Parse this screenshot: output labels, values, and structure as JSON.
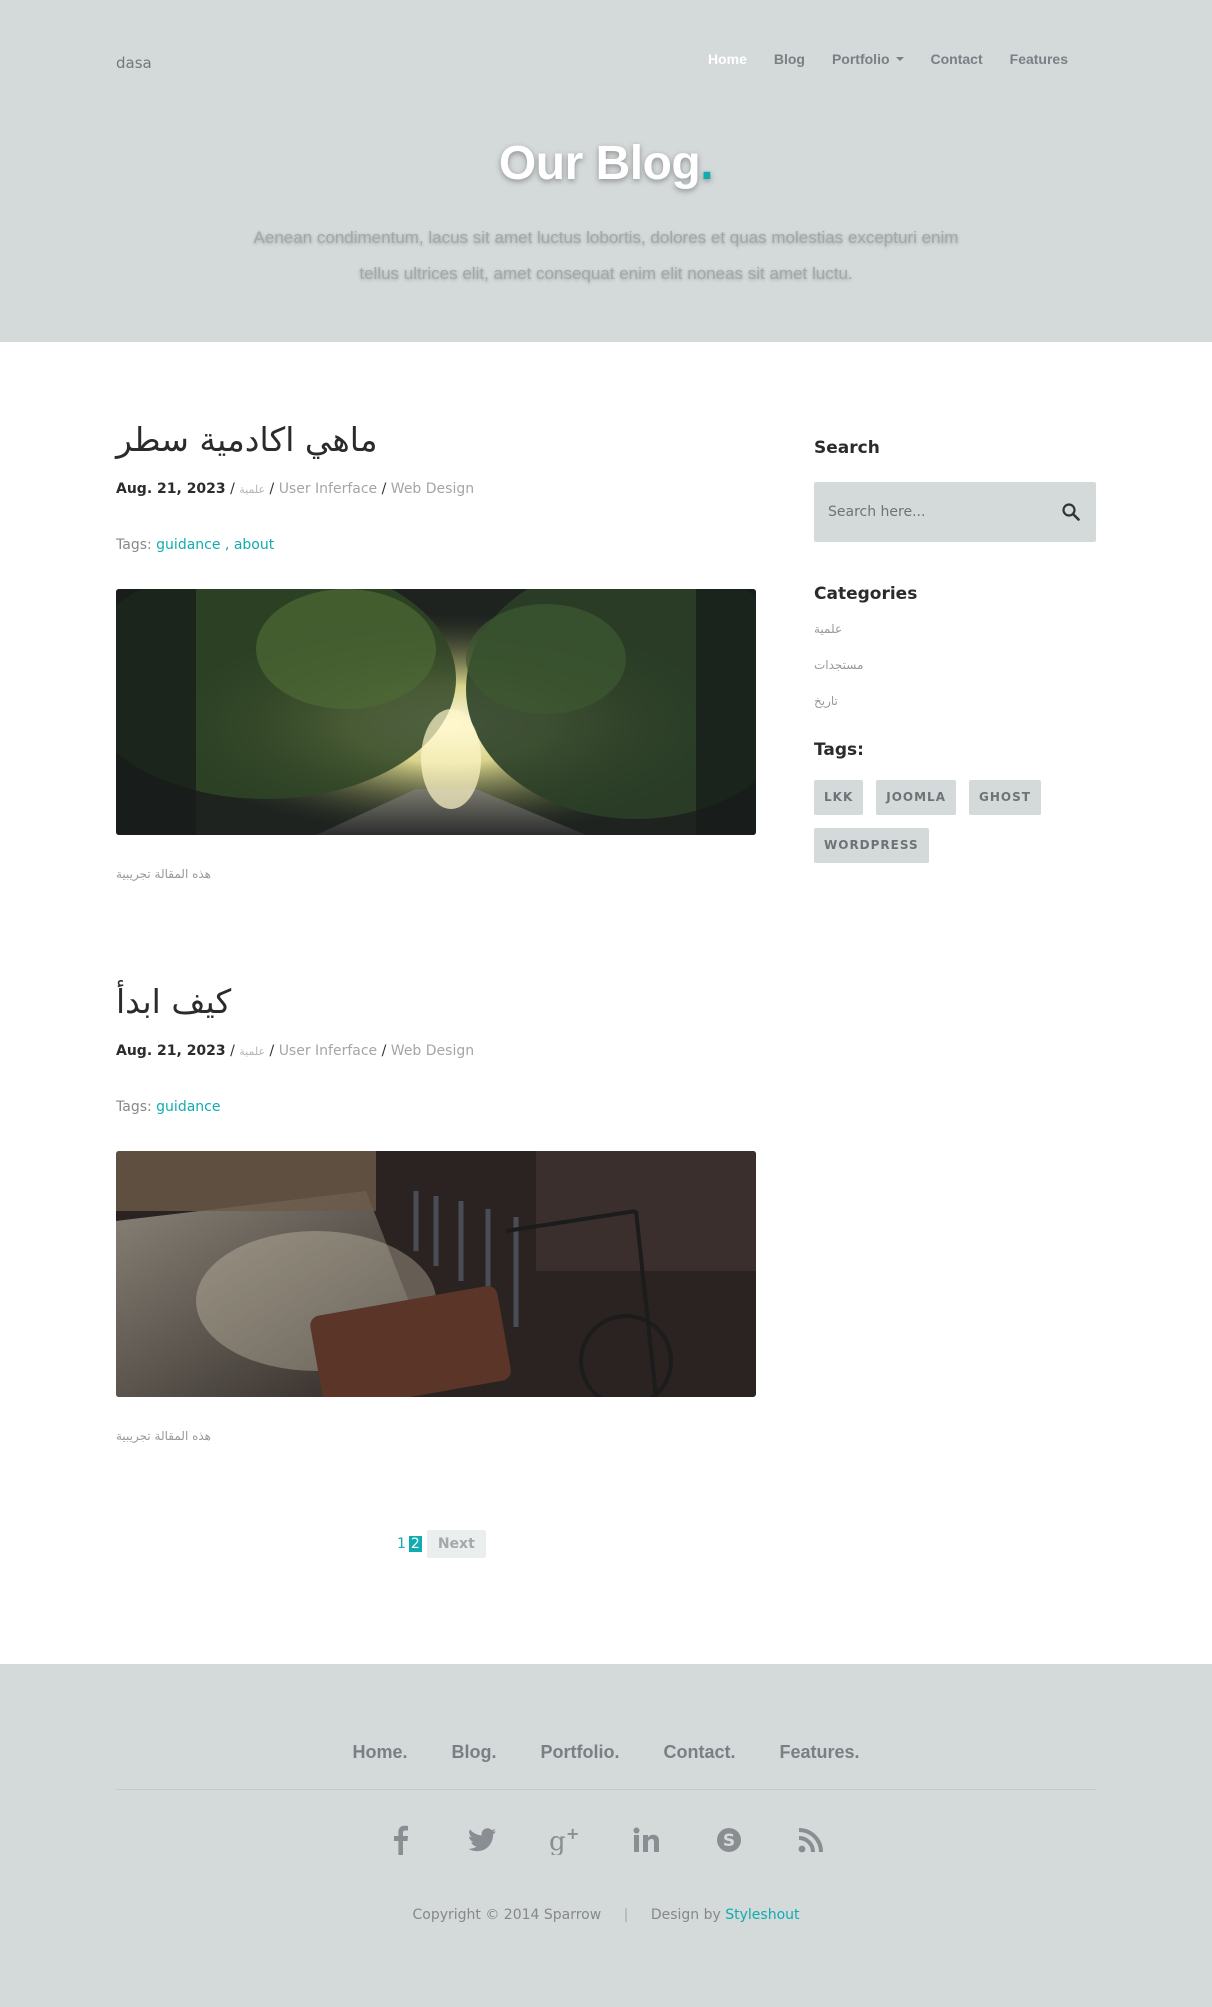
{
  "header": {
    "logo": "dasa",
    "nav": [
      {
        "label": "Home",
        "active": true
      },
      {
        "label": "Blog"
      },
      {
        "label": "Portfolio",
        "dropdown": true
      },
      {
        "label": "Contact"
      },
      {
        "label": "Features"
      }
    ],
    "title": "Our Blog",
    "title_dot": ".",
    "subtitle": "Aenean condimentum, lacus sit amet luctus lobortis, dolores et quas molestias excepturi enim tellus ultrices elit, amet consequat enim elit noneas sit amet luctu."
  },
  "posts": [
    {
      "title": "ماهي اكادمية سطر",
      "date": "Aug. 21, 2023",
      "category": "علمية",
      "meta_cats": [
        "User Inferface",
        "Web Design"
      ],
      "tags_label": "Tags:",
      "tags": [
        "guidance",
        "about"
      ],
      "excerpt": "هذه المقالة تجريبية",
      "image": "sunlit-tree-lined-road-image"
    },
    {
      "title": "كيف ابدأ",
      "date": "Aug. 21, 2023",
      "category": "علمية",
      "meta_cats": [
        "User Inferface",
        "Web Design"
      ],
      "tags_label": "Tags:",
      "tags": [
        "guidance"
      ],
      "excerpt": "هذه المقالة تجريبية",
      "image": "bicycle-street-image"
    }
  ],
  "pagination": {
    "pages": [
      "1",
      "2"
    ],
    "current": "2",
    "next_label": "Next"
  },
  "sidebar": {
    "search_heading": "Search",
    "search_placeholder": "Search here...",
    "categories_heading": "Categories",
    "categories": [
      "علمية",
      "مستجدات",
      "تاريخ"
    ],
    "tags_heading": "Tags:",
    "tags": [
      "LKK",
      "JOOMLA",
      "GHOST",
      "WORDPRESS"
    ]
  },
  "footer": {
    "nav": [
      "Home.",
      "Blog.",
      "Portfolio.",
      "Contact.",
      "Features."
    ],
    "social": [
      "facebook-icon",
      "twitter-icon",
      "google-plus-icon",
      "linkedin-icon",
      "skype-icon",
      "rss-icon"
    ],
    "copyright": "Copyright © 2014 Sparrow",
    "pipe": "|",
    "design_by": "Design by",
    "credit": "Styleshout"
  },
  "colors": {
    "accent": "#11abb0",
    "header_bg": "#d4d9da",
    "nav_text": "#7b7f84",
    "heading_text": "#2b2b2b"
  }
}
